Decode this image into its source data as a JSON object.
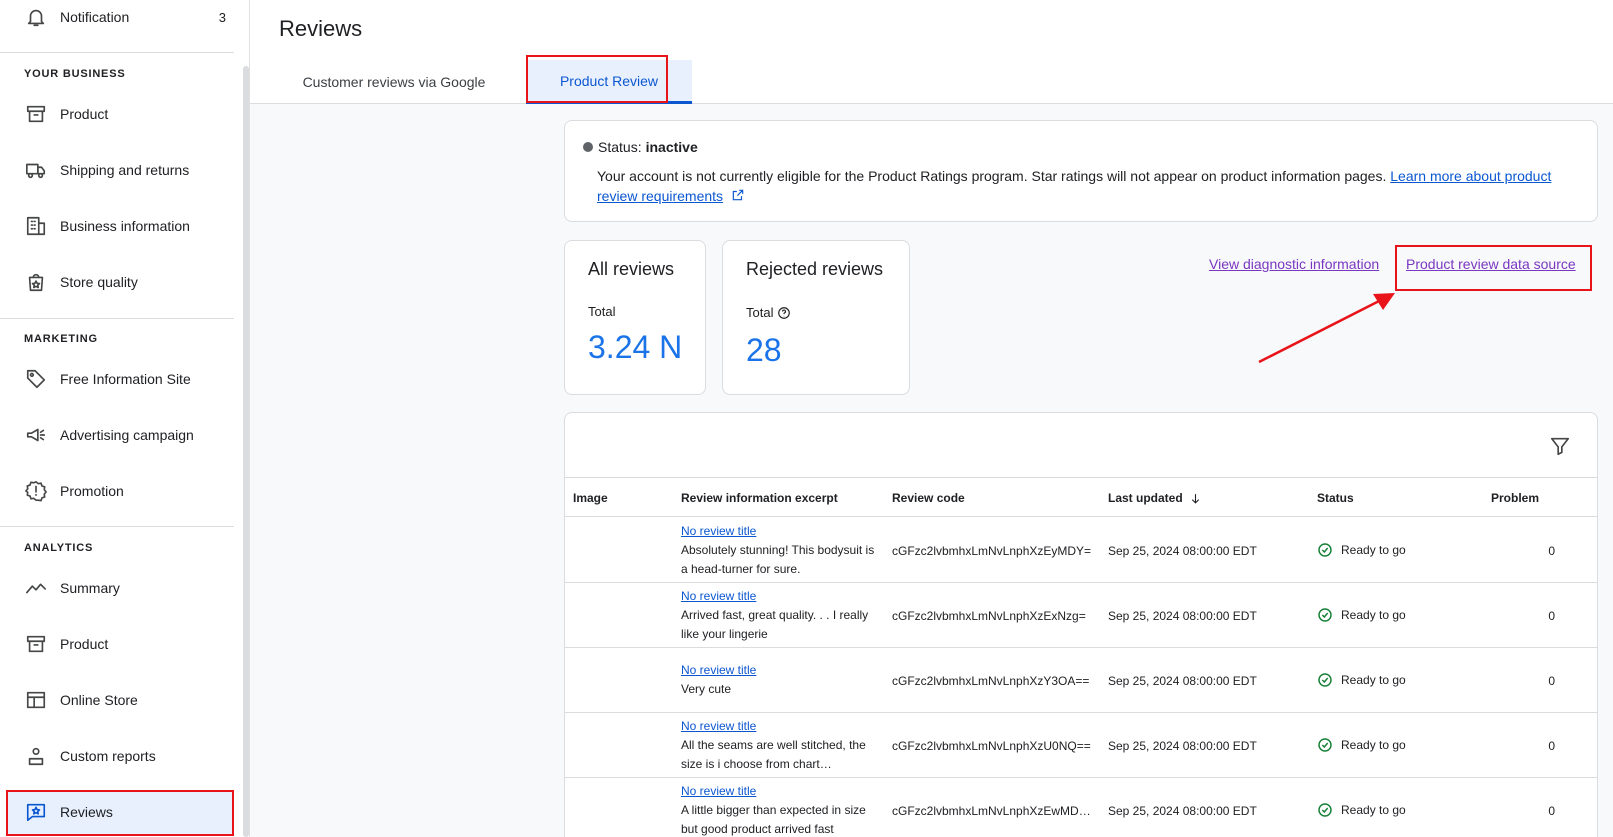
{
  "sidebar": {
    "notification": {
      "label": "Notification",
      "count": "3"
    },
    "sections": [
      {
        "title": "YOUR BUSINESS"
      },
      {
        "title": "MARKETING"
      },
      {
        "title": "ANALYTICS"
      }
    ],
    "items": [
      {
        "label": "Product",
        "icon": "archive-icon"
      },
      {
        "label": "Shipping and returns",
        "icon": "truck-icon"
      },
      {
        "label": "Business information",
        "icon": "building-icon"
      },
      {
        "label": "Store quality",
        "icon": "shopping-bag-star-icon"
      },
      {
        "label": "Free Information Site",
        "icon": "tag-icon"
      },
      {
        "label": "Advertising campaign",
        "icon": "megaphone-icon"
      },
      {
        "label": "Promotion",
        "icon": "badge-alert-icon"
      },
      {
        "label": "Summary",
        "icon": "trend-line-icon"
      },
      {
        "label": "Product",
        "icon": "archive-icon"
      },
      {
        "label": "Online Store",
        "icon": "storefront-icon"
      },
      {
        "label": "Custom reports",
        "icon": "person-report-icon"
      },
      {
        "label": "Reviews",
        "icon": "review-star-icon"
      }
    ]
  },
  "header": {
    "title": "Reviews",
    "tabs": [
      {
        "label": "Customer reviews via Google"
      },
      {
        "label": "Product Review"
      }
    ]
  },
  "status_card": {
    "label": "Status:",
    "value": "inactive",
    "message": "Your account is not currently eligible for the Product Ratings program. Star ratings will not appear on product information pages.",
    "link": "Learn more about product review requirements"
  },
  "stats": [
    {
      "title": "All reviews",
      "label": "Total",
      "value": "3.24 N"
    },
    {
      "title": "Rejected reviews",
      "label": "Total",
      "value": "28"
    }
  ],
  "links": {
    "diagnostic": "View diagnostic information",
    "data_source": "Product review data source"
  },
  "table": {
    "columns": [
      "Image",
      "Review information excerpt",
      "Review code",
      "Last updated",
      "Status",
      "Problem"
    ],
    "rows": [
      {
        "title": "No review title",
        "excerpt": "Absolutely stunning! This bodysuit is a head-turner for sure.",
        "code": "cGFzc2lvbmhxLmNvLnphXzEyMDY=",
        "updated": "Sep 25, 2024 08:00:00 EDT",
        "status": "Ready to go",
        "problem": "0"
      },
      {
        "title": "No review title",
        "excerpt": "Arrived fast, great quality. . . I really like your lingerie",
        "code": "cGFzc2lvbmhxLmNvLnphXzExNzg=",
        "updated": "Sep 25, 2024 08:00:00 EDT",
        "status": "Ready to go",
        "problem": "0"
      },
      {
        "title": "No review title",
        "excerpt": "Very cute",
        "code": "cGFzc2lvbmhxLmNvLnphXzY3OA==",
        "updated": "Sep 25, 2024 08:00:00 EDT",
        "status": "Ready to go",
        "problem": "0"
      },
      {
        "title": "No review title",
        "excerpt": "All the seams are well stitched, the size is i choose from chart…",
        "code": "cGFzc2lvbmhxLmNvLnphXzU0NQ==",
        "updated": "Sep 25, 2024 08:00:00 EDT",
        "status": "Ready to go",
        "problem": "0"
      },
      {
        "title": "No review title",
        "excerpt": "A little bigger than expected in size but good product arrived fast",
        "code": "cGFzc2lvbmhxLmNvLnphXzEwMD…",
        "updated": "Sep 25, 2024 08:00:00 EDT",
        "status": "Ready to go",
        "problem": "0"
      }
    ]
  },
  "colors": {
    "accent": "#0b57d0",
    "highlight": "#e8141a",
    "success": "#188038"
  }
}
